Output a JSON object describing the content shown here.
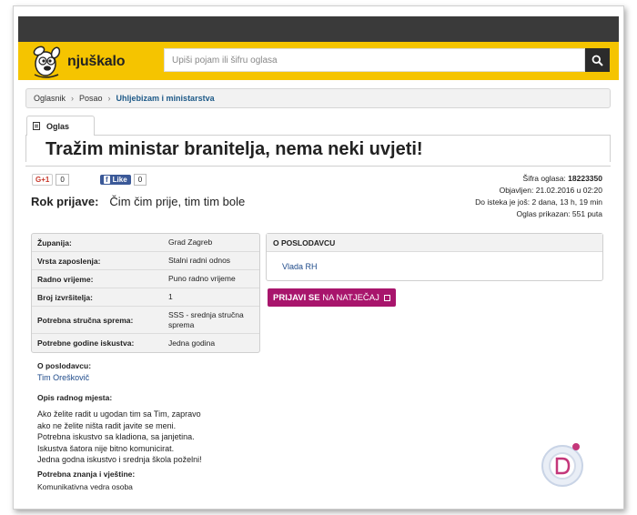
{
  "header": {
    "logo_text": "njuškalo",
    "search_placeholder": "Upiši pojam ili šifru oglasa"
  },
  "breadcrumb": [
    "Oglasnik",
    "Posao",
    "Uhljebizam i ministarstva"
  ],
  "tab": {
    "label": "Oglas"
  },
  "ad": {
    "title": "Tražim ministar branitelja, nema neki uvjeti!",
    "social": {
      "gplus_label": "G+1",
      "gplus_count": "0",
      "fb_label": "Like",
      "fb_count": "0"
    },
    "meta": {
      "sifra_label": "Šifra oglasa:",
      "sifra_value": "18223350",
      "objavljen": "Objavljen: 21.02.2016 u 02:20",
      "do_isteka": "Do isteka je još: 2 dana, 13 h, 19 min",
      "prikazan": "Oglas prikazan: 551 puta"
    },
    "rok": {
      "label": "Rok prijave:",
      "value": "Čim čim prije, tim tim bole"
    },
    "details": [
      {
        "key": "Županija:",
        "value": "Grad Zagreb"
      },
      {
        "key": "Vrsta zaposlenja:",
        "value": "Stalni radni odnos"
      },
      {
        "key": "Radno vrijeme:",
        "value": "Puno radno vrijeme"
      },
      {
        "key": "Broj izvršitelja:",
        "value": "1"
      },
      {
        "key": "Potrebna stručna sprema:",
        "value": "SSS - srednja stručna sprema"
      },
      {
        "key": "Potrebne godine iskustva:",
        "value": "Jedna godina"
      }
    ],
    "employer_box": {
      "header": "O POSLODAVCU",
      "name": "Vlada RH"
    },
    "apply_button": {
      "bold": "PRIJAVI SE",
      "rest": " NA NATJEČAJ"
    },
    "o_poslodavcu": {
      "label": "O poslodavcu:",
      "name": "Tim Oreškovič"
    },
    "opis": {
      "label": "Opis radnog mjesta:",
      "lines": [
        "Ako želite radit u ugodan tim sa Tim, zapravo",
        "ako ne želite ništa radit javite se meni.",
        "Potrebna iskustvo sa kladiona, sa janjetina.",
        "Iskustva šatora nije bitno komunicirat.",
        "Jedna godna iskustvo i srednja škola poželni!"
      ]
    },
    "znanja": {
      "label": "Potrebna znanja i vještine:",
      "value": "Komunikativna vedra osoba"
    }
  },
  "colors": {
    "brand_yellow": "#f5c400",
    "apply_magenta": "#a8156c",
    "link_blue": "#1e4a8a"
  }
}
